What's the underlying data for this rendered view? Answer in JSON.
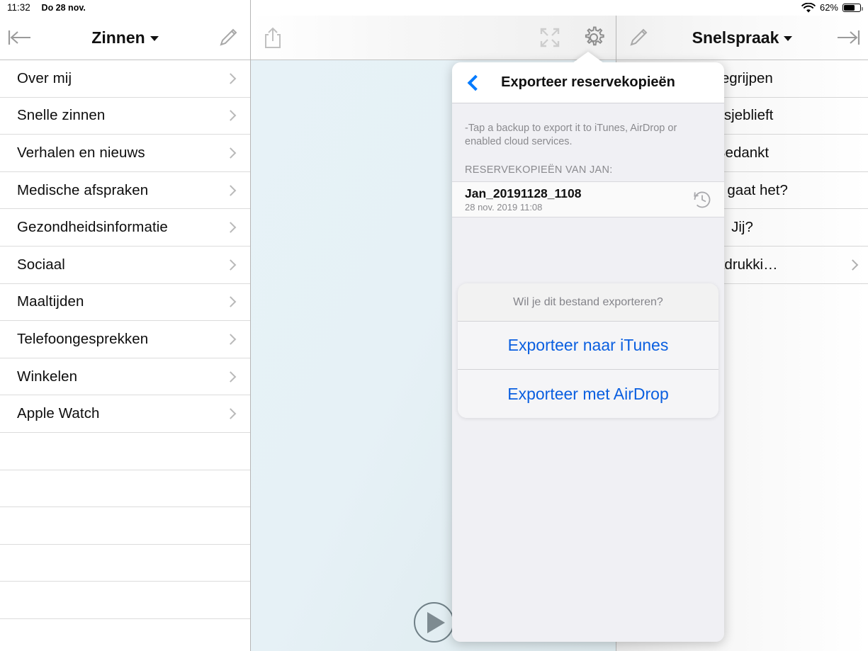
{
  "statusbar": {
    "time": "11:32",
    "date": "Do 28 nov.",
    "wifi_icon": "wifi-icon",
    "battery_percent": "62%",
    "battery_level": 62
  },
  "left_panel": {
    "toolbar": {
      "back_icon": "back-arrow-icon",
      "title": "Zinnen",
      "edit_icon": "pencil-icon"
    },
    "items": [
      {
        "label": "Over mij"
      },
      {
        "label": "Snelle zinnen"
      },
      {
        "label": "Verhalen en nieuws"
      },
      {
        "label": "Medische afspraken"
      },
      {
        "label": "Gezondheidsinformatie"
      },
      {
        "label": "Sociaal"
      },
      {
        "label": "Maaltijden"
      },
      {
        "label": "Telefoongesprekken"
      },
      {
        "label": "Winkelen"
      },
      {
        "label": "Apple Watch"
      }
    ],
    "empty_row_count": 6
  },
  "center_panel": {
    "toolbar": {
      "share_icon": "share-icon",
      "expand_icon": "expand-icon",
      "settings_icon": "gear-icon"
    },
    "play_icon": "play-icon"
  },
  "right_panel": {
    "toolbar": {
      "edit_icon": "pencil-icon",
      "title": "Snelspraak",
      "forward_icon": "forward-arrow-icon"
    },
    "items": [
      {
        "label": "Begrijpen",
        "chevron": false
      },
      {
        "label": "Alsjeblieft",
        "chevron": false
      },
      {
        "label": "Bedankt",
        "chevron": false
      },
      {
        "label": "Hoe gaat het?",
        "chevron": false
      },
      {
        "label": "Jij?",
        "chevron": false
      },
      {
        "label": "Uitdrukki…",
        "chevron": true
      }
    ]
  },
  "popover": {
    "back_icon": "back-chevron-icon",
    "title": "Exporteer reservekopieën",
    "hint": "-Tap a backup to export it to iTunes, AirDrop or enabled cloud services.",
    "section_header": "RESERVEKOPIEËN VAN JAN:",
    "backup": {
      "name": "Jan_20191128_1108",
      "date": "28 nov. 2019 11:08",
      "history_icon": "history-clock-icon"
    }
  },
  "action_sheet": {
    "title": "Wil je dit bestand exporteren?",
    "buttons": [
      {
        "label": "Exporteer naar iTunes"
      },
      {
        "label": "Exporteer met AirDrop"
      }
    ]
  },
  "colors": {
    "accent_blue": "#007aff",
    "action_blue": "#0a5fe0",
    "canvas_blue": "#e7f2f7",
    "muted_gray": "#8a8a8e"
  }
}
